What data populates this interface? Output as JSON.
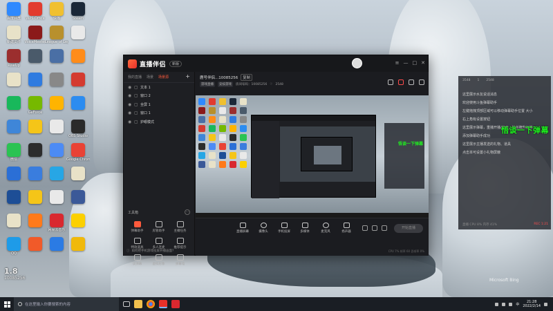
{
  "desktop": {
    "icons": [
      {
        "label": "百度网盘",
        "color": "#2e89ff"
      },
      {
        "label": "WPS Office",
        "color": "#e23b2e"
      },
      {
        "label": "快猫",
        "color": "#f0c030"
      },
      {
        "label": "Steam",
        "color": "#1b2838"
      },
      {
        "label": "新建文件",
        "color": "#e8e2c8"
      },
      {
        "label": "VoiceMeeter",
        "color": "#8b1a1a"
      },
      {
        "label": "League of Legends",
        "color": "#b8902d"
      },
      {
        "label": "",
        "color": "#e9e9e9"
      },
      {
        "label": "RiseUp",
        "color": "#9b2e2e"
      },
      {
        "label": "",
        "color": "#4a5a6a"
      },
      {
        "label": "",
        "color": "#4a6fa5"
      },
      {
        "label": "",
        "color": "#ff8c1a"
      },
      {
        "label": "",
        "color": "#e8e2c8"
      },
      {
        "label": "",
        "color": "#2f7be0"
      },
      {
        "label": "",
        "color": "#888"
      },
      {
        "label": "",
        "color": "#d43b30"
      },
      {
        "label": "",
        "color": "#18b85b"
      },
      {
        "label": "GeForce",
        "color": "#76b900"
      },
      {
        "label": "",
        "color": "#ffb400"
      },
      {
        "label": "",
        "color": "#2c8cf0"
      },
      {
        "label": "",
        "color": "#3f86d8"
      },
      {
        "label": "",
        "color": "#f5c518"
      },
      {
        "label": "",
        "color": "#e9e9e9"
      },
      {
        "label": "OBS Studio",
        "color": "#2a2a2a"
      },
      {
        "label": "微信",
        "color": "#2bc352"
      },
      {
        "label": "",
        "color": "#2c2c2c"
      },
      {
        "label": "",
        "color": "#4c8bf5"
      },
      {
        "label": "Google Chrome",
        "color": "#e94235"
      },
      {
        "label": "",
        "color": "#2b6fd6"
      },
      {
        "label": "",
        "color": "#3a7dde"
      },
      {
        "label": "",
        "color": "#27a6e5"
      },
      {
        "label": "",
        "color": "#e8e2c8"
      },
      {
        "label": "",
        "color": "#1d4e96"
      },
      {
        "label": "",
        "color": "#f5c518"
      },
      {
        "label": "",
        "color": "#e9e9e9"
      },
      {
        "label": "",
        "color": "#3b5998"
      },
      {
        "label": "",
        "color": "#e8e2c8"
      },
      {
        "label": "",
        "color": "#ff7a1a"
      },
      {
        "label": "网易云音乐",
        "color": "#d9282f"
      },
      {
        "label": "",
        "color": "#fcd000"
      },
      {
        "label": "QQ",
        "color": "#1e9be8"
      },
      {
        "label": "",
        "color": "#f15a29"
      },
      {
        "label": "",
        "color": "#2b7be4"
      },
      {
        "label": "",
        "color": "#f0b90b"
      }
    ],
    "watermark": "Microsoft Bing",
    "badge_line1": "1.8",
    "badge_line2": "10085256"
  },
  "app": {
    "name": "直播伴侣",
    "version_badge": "新版",
    "title_buttons": [
      "≡",
      "—",
      "□",
      "✕"
    ],
    "left_tabs": [
      "我的直播",
      "场景",
      "场景源"
    ],
    "active_left_tab": 2,
    "scenes": [
      {
        "label": "文本 1"
      },
      {
        "label": "窗口 2"
      },
      {
        "label": "全屏 1"
      },
      {
        "label": "窗口 1"
      },
      {
        "label": "护眼模式"
      }
    ],
    "toolbox_title": "工具箱",
    "tools": [
      {
        "label": "弹幕助手",
        "hot": true
      },
      {
        "label": "房管助手",
        "hot": false
      },
      {
        "label": "主播任务",
        "hot": false
      },
      {
        "label": "特效道具",
        "hot": false
      },
      {
        "label": "多人连麦",
        "hot": false
      },
      {
        "label": "推荐提示",
        "hot": false
      },
      {
        "label": "读弹幕",
        "hot": false
      },
      {
        "label": "虚拟形象",
        "hot": false
      },
      {
        "label": "弹幕墙",
        "hot": false
      }
    ],
    "footer_tip": "如何把手机游戏投屏开播画面？",
    "room_title": "鹿号伴侣...10085256",
    "room_copy": "复制",
    "meta_chips": [
      "游戏直播",
      "竞技游戏"
    ],
    "meta_room": "房间号码：10085256",
    "meta_likes": "2548",
    "controls": [
      {
        "label": "直播屏幕"
      },
      {
        "label": "摄像头"
      },
      {
        "label": "手机投屏"
      },
      {
        "label": "多媒体"
      },
      {
        "label": "麦克风"
      },
      {
        "label": "扬声器"
      }
    ],
    "start_button": "开始直播",
    "status": "CPU 7%  帧率 60  丢帧率 0%"
  },
  "side_panel": {
    "top_stats": [
      "3548",
      "1",
      "2548"
    ],
    "messages": [
      "这里展示水友说话消息",
      "欢迎使用斗鱼弹幕助手",
      "左键拖拽顶部区域可以移动弹幕助手位置 大小",
      "右上角有设置按钮",
      "这里展示弹幕，重播开播/结束，粉丝牌升级等",
      "添加弹幕助手成功",
      "这里展示主播发送的礼物、道具",
      "点击本可设置小礼物屏蔽"
    ],
    "bottom_left": "直播 CPU 8% 内存 41%",
    "bottom_right": "REC 1:21"
  },
  "overlay_banner": "悟谈一下弹幕",
  "taskbar": {
    "search_placeholder": "在这里输入你要搜索的内容",
    "time": "21:28",
    "date": "2022/2/14",
    "lang": "中"
  }
}
